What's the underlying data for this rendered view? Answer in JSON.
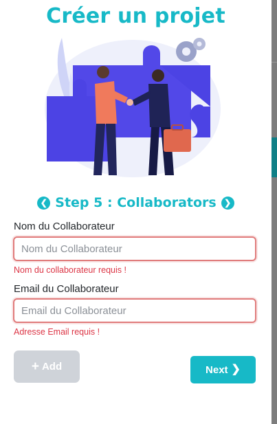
{
  "title": "Créer un projet",
  "step": {
    "title": "Step 5 : Collaborators",
    "prev_icon": "chevron-left-icon",
    "next_icon": "chevron-right-icon"
  },
  "form": {
    "name_label": "Nom du Collaborateur",
    "name_placeholder": "Nom du Collaborateur",
    "name_value": "",
    "name_error": "Nom du collaborateur requis !",
    "email_label": "Email du Collaborateur",
    "email_placeholder": "Email du Collaborateur",
    "email_value": "",
    "email_error": "Adresse Email requis !"
  },
  "buttons": {
    "add_label": "Add",
    "add_icon": "plus-icon",
    "next_label": "Next",
    "next_icon": "chevron-right-icon"
  },
  "colors": {
    "accent": "#17b9c7",
    "error": "#dc3545",
    "input_border_error": "#e07a7a",
    "disabled_button": "#cfd3d9"
  }
}
